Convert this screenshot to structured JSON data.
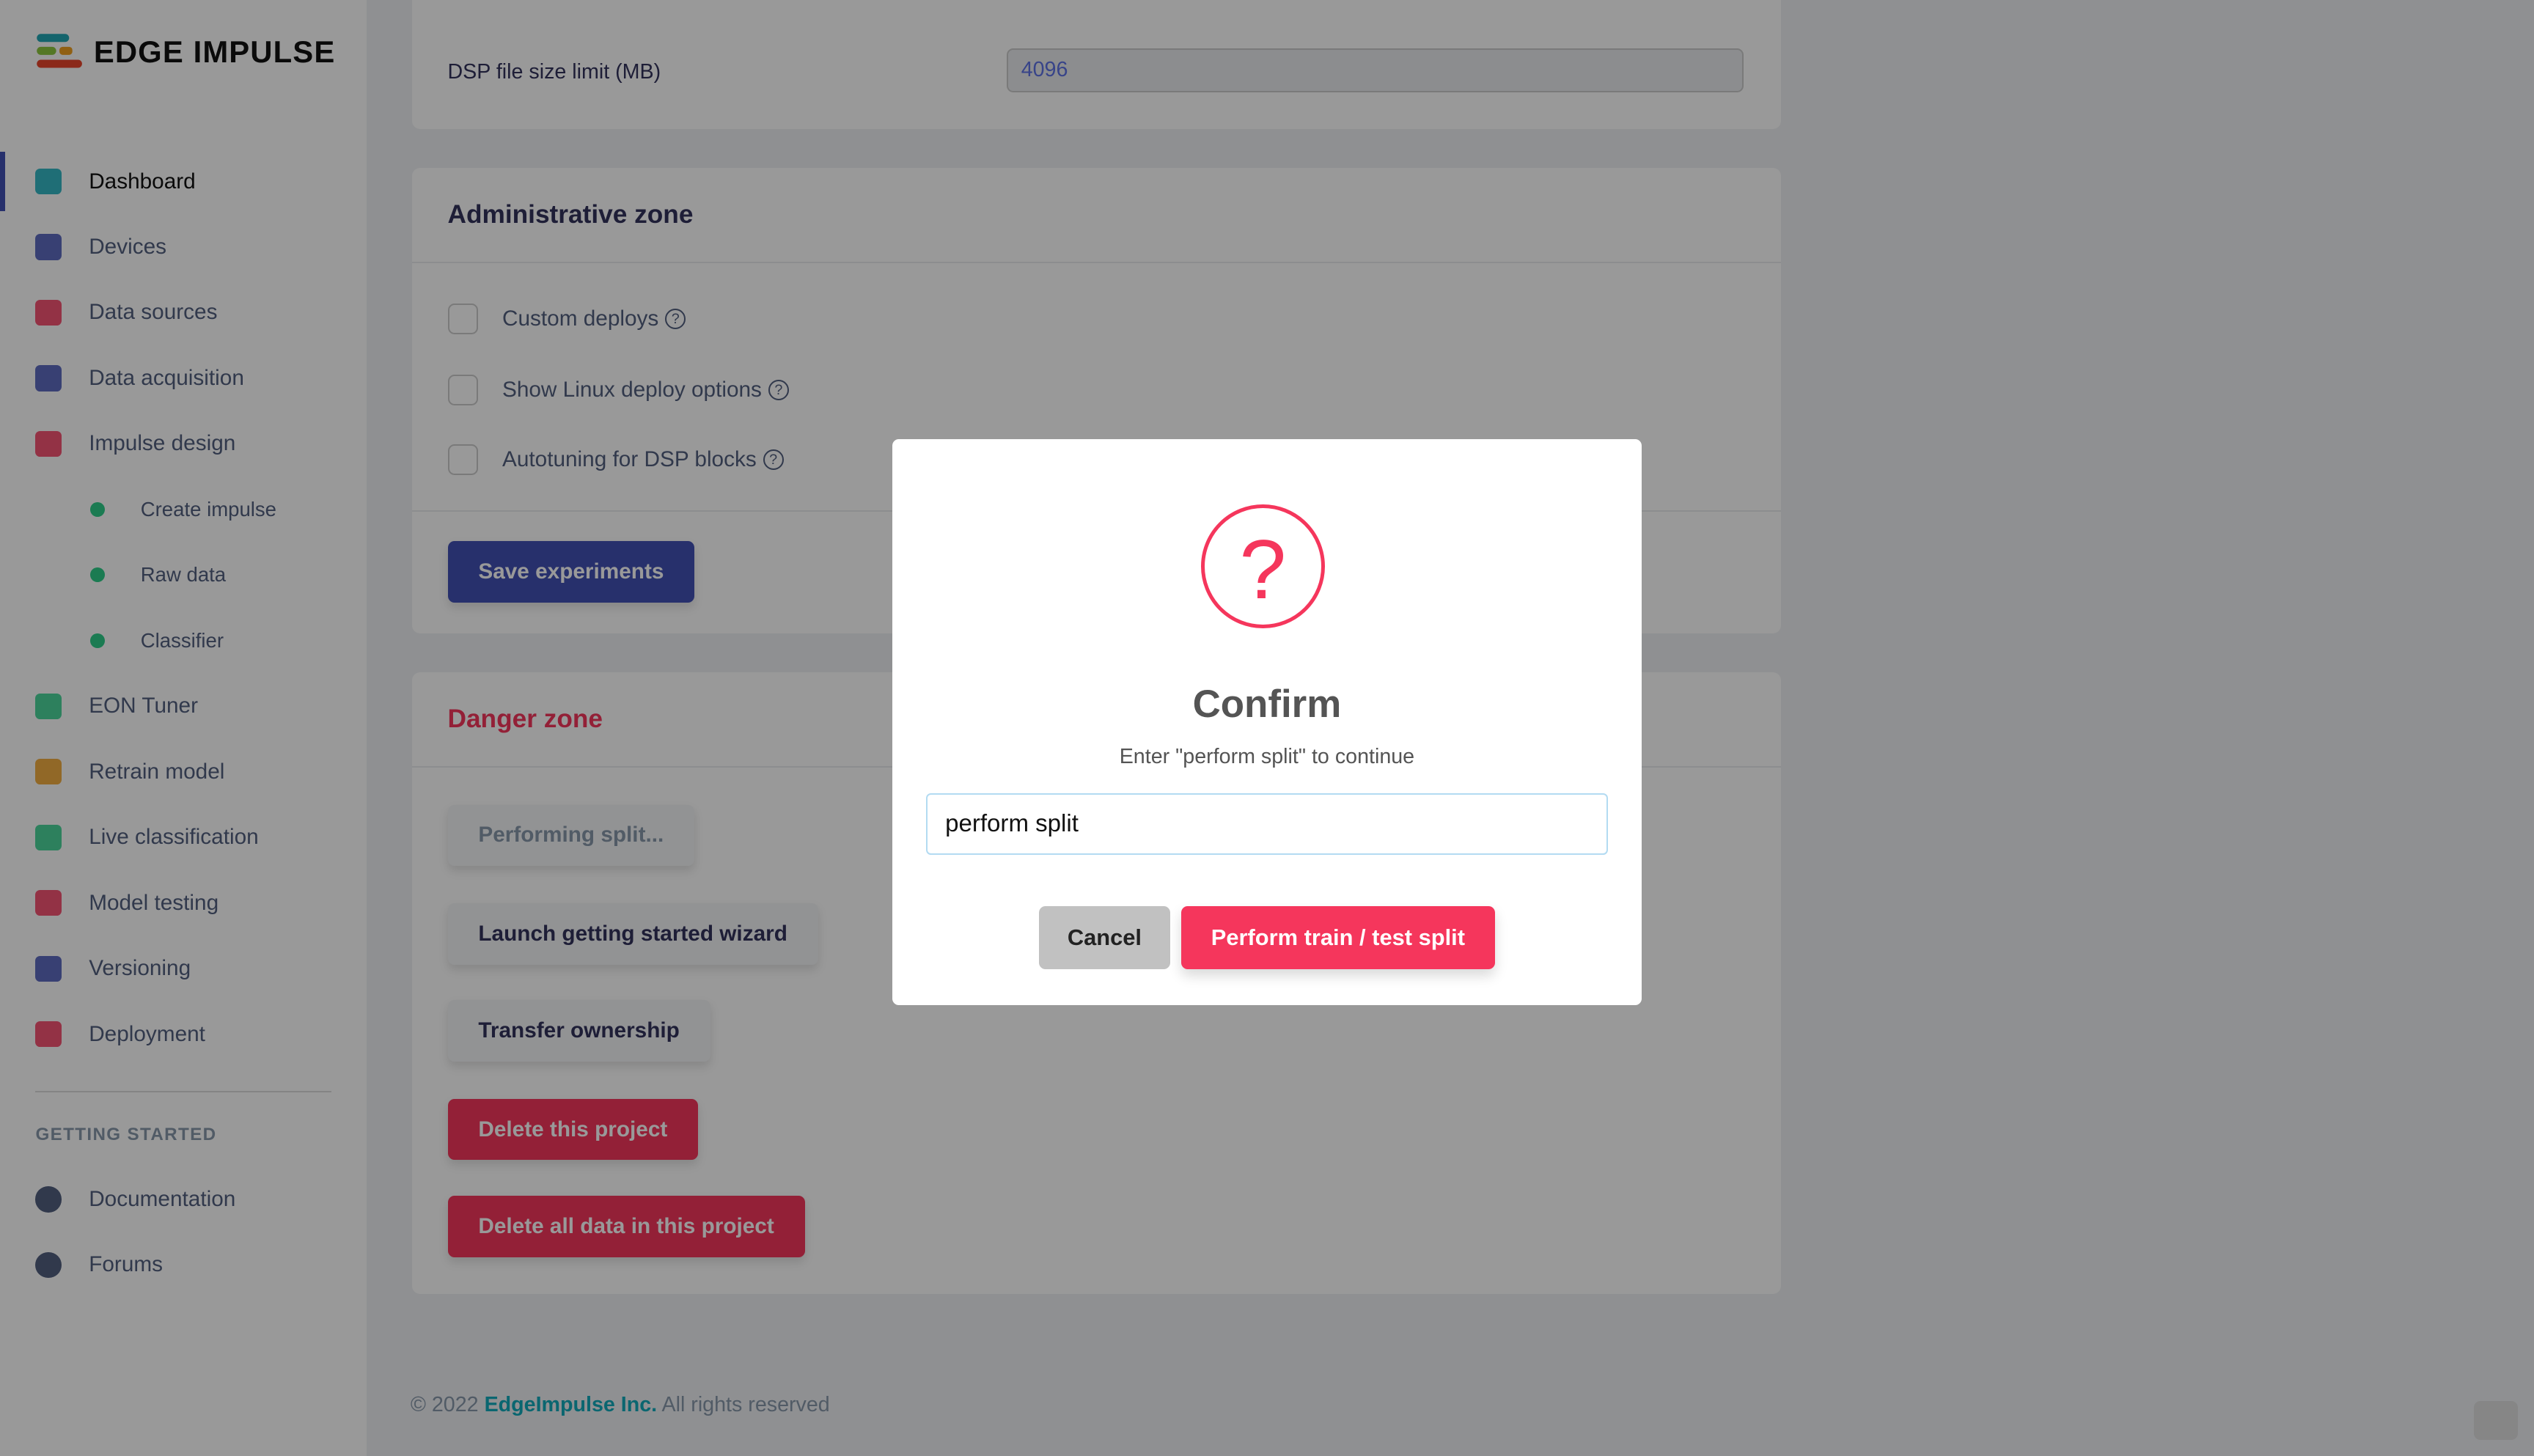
{
  "brand": {
    "name": "EDGE IMPULSE"
  },
  "sidebar": {
    "items": [
      {
        "label": "Dashboard",
        "icon": "monitor-icon",
        "color": "#11aabb"
      },
      {
        "label": "Devices",
        "icon": "chip-icon",
        "color": "#4251b5"
      },
      {
        "label": "Data sources",
        "icon": "wand-icon",
        "color": "#f5365c"
      },
      {
        "label": "Data acquisition",
        "icon": "database-icon",
        "color": "#4251b5"
      },
      {
        "label": "Impulse design",
        "icon": "pulse-icon",
        "color": "#f5365c"
      },
      {
        "label": "Create impulse",
        "sub": true
      },
      {
        "label": "Raw data",
        "sub": true
      },
      {
        "label": "Classifier",
        "sub": true
      },
      {
        "label": "EON Tuner",
        "icon": "compass-icon",
        "color": "#2dce89"
      },
      {
        "label": "Retrain model",
        "icon": "shuffle-icon",
        "color": "#f0a020"
      },
      {
        "label": "Live classification",
        "icon": "nodes-icon",
        "color": "#2dce89"
      },
      {
        "label": "Model testing",
        "icon": "clipboard-check-icon",
        "color": "#f5365c"
      },
      {
        "label": "Versioning",
        "icon": "branch-icon",
        "color": "#4251b5"
      },
      {
        "label": "Deployment",
        "icon": "cube-icon",
        "color": "#f5365c"
      }
    ],
    "getting_started_heading": "GETTING STARTED",
    "getting_started": [
      {
        "label": "Documentation",
        "icon": "rocket-icon"
      },
      {
        "label": "Forums",
        "icon": "chat-bubbles-icon"
      }
    ]
  },
  "main": {
    "dsp_label": "DSP file size limit (MB)",
    "dsp_value": "4096",
    "admin": {
      "title": "Administrative zone",
      "options": [
        "Custom deploys",
        "Show Linux deploy options",
        "Autotuning for DSP blocks"
      ],
      "save": "Save experiments"
    },
    "danger": {
      "title": "Danger zone",
      "buttons": [
        "Performing split...",
        "Launch getting started wizard",
        "Transfer ownership",
        "Delete this project",
        "Delete all data in this project"
      ]
    }
  },
  "footer": {
    "copy": "© 2022",
    "company": "EdgeImpulse Inc.",
    "rights": "All rights reserved"
  },
  "modal": {
    "icon": "?",
    "title": "Confirm",
    "text": "Enter \"perform split\" to continue",
    "input_value": "perform split",
    "cancel": "Cancel",
    "confirm": "Perform train / test split"
  }
}
